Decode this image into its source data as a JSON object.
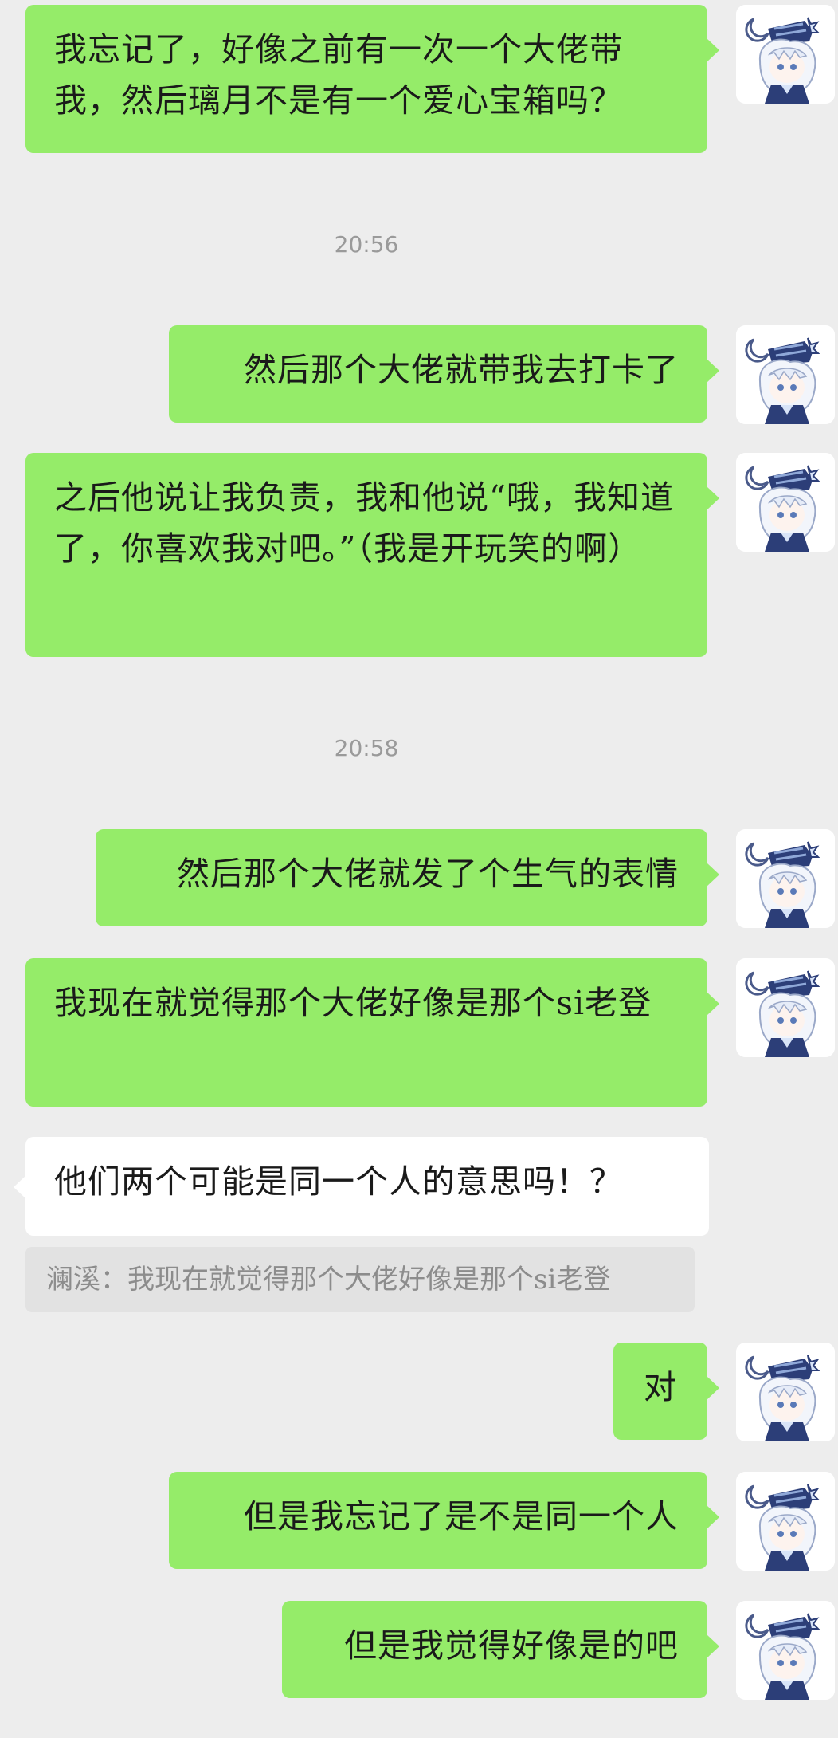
{
  "messages": {
    "m1": "我忘记了，好像之前有一次一个大佬带我，然后璃月不是有一个爱心宝箱吗？",
    "m2": "然后那个大佬就带我去打卡了",
    "m3": "之后他说让我负责，我和他说“哦，我知道了，你喜欢我对吧。”（我是开玩笑的啊）",
    "m4": "然后那个大佬就发了个生气的表情",
    "m5": "我现在就觉得那个大佬好像是那个si老登",
    "m6": "他们两个可能是同一个人的意思吗！？",
    "m7": "对",
    "m8": "但是我忘记了是不是同一个人",
    "m9": "但是我觉得好像是的吧"
  },
  "timestamps": {
    "t1": "20:56",
    "t2": "20:58"
  },
  "quote": {
    "text": "澜溪：我现在就觉得那个大佬好像是那个si老登"
  },
  "colors": {
    "background": "#ededed",
    "sent_bubble": "#95ec69",
    "received_bubble": "#ffffff",
    "quote_background": "#e2e2e2"
  },
  "icons": {
    "avatar": "anime-character-avatar-icon"
  }
}
